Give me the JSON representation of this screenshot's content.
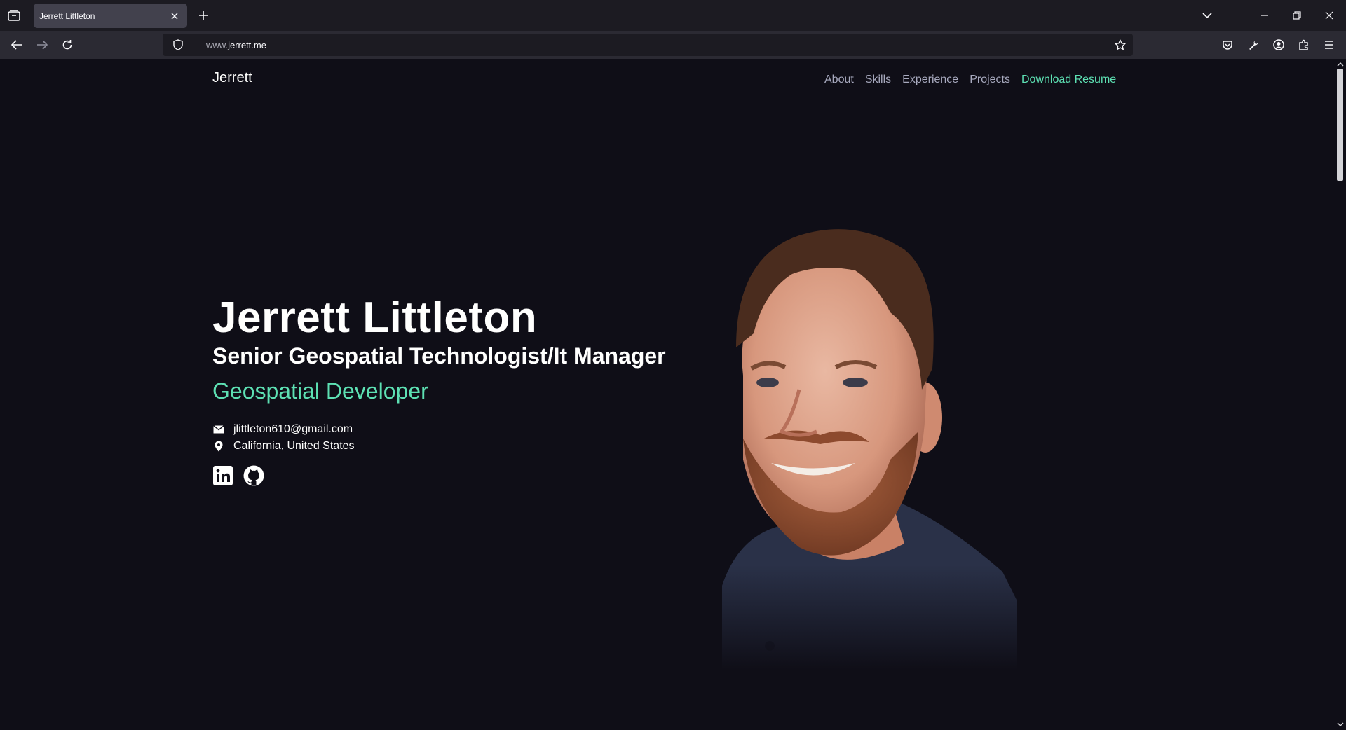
{
  "browser": {
    "tab_title": "Jerrett Littleton",
    "url_prefix": "www.",
    "url_domain": "jerrett.me"
  },
  "site": {
    "brand": "Jerrett",
    "nav": [
      {
        "label": "About"
      },
      {
        "label": "Skills"
      },
      {
        "label": "Experience"
      },
      {
        "label": "Projects"
      },
      {
        "label": "Download Resume"
      }
    ],
    "accent_color": "#5de0b3",
    "background_color": "#0f0e17"
  },
  "hero": {
    "name": "Jerrett Littleton",
    "title": "Senior Geospatial Technologist/It Manager",
    "role": "Geospatial Developer",
    "email": "jlittleton610@gmail.com",
    "location": "California, United States",
    "socials": [
      {
        "icon": "linkedin-icon"
      },
      {
        "icon": "github-icon"
      }
    ]
  }
}
